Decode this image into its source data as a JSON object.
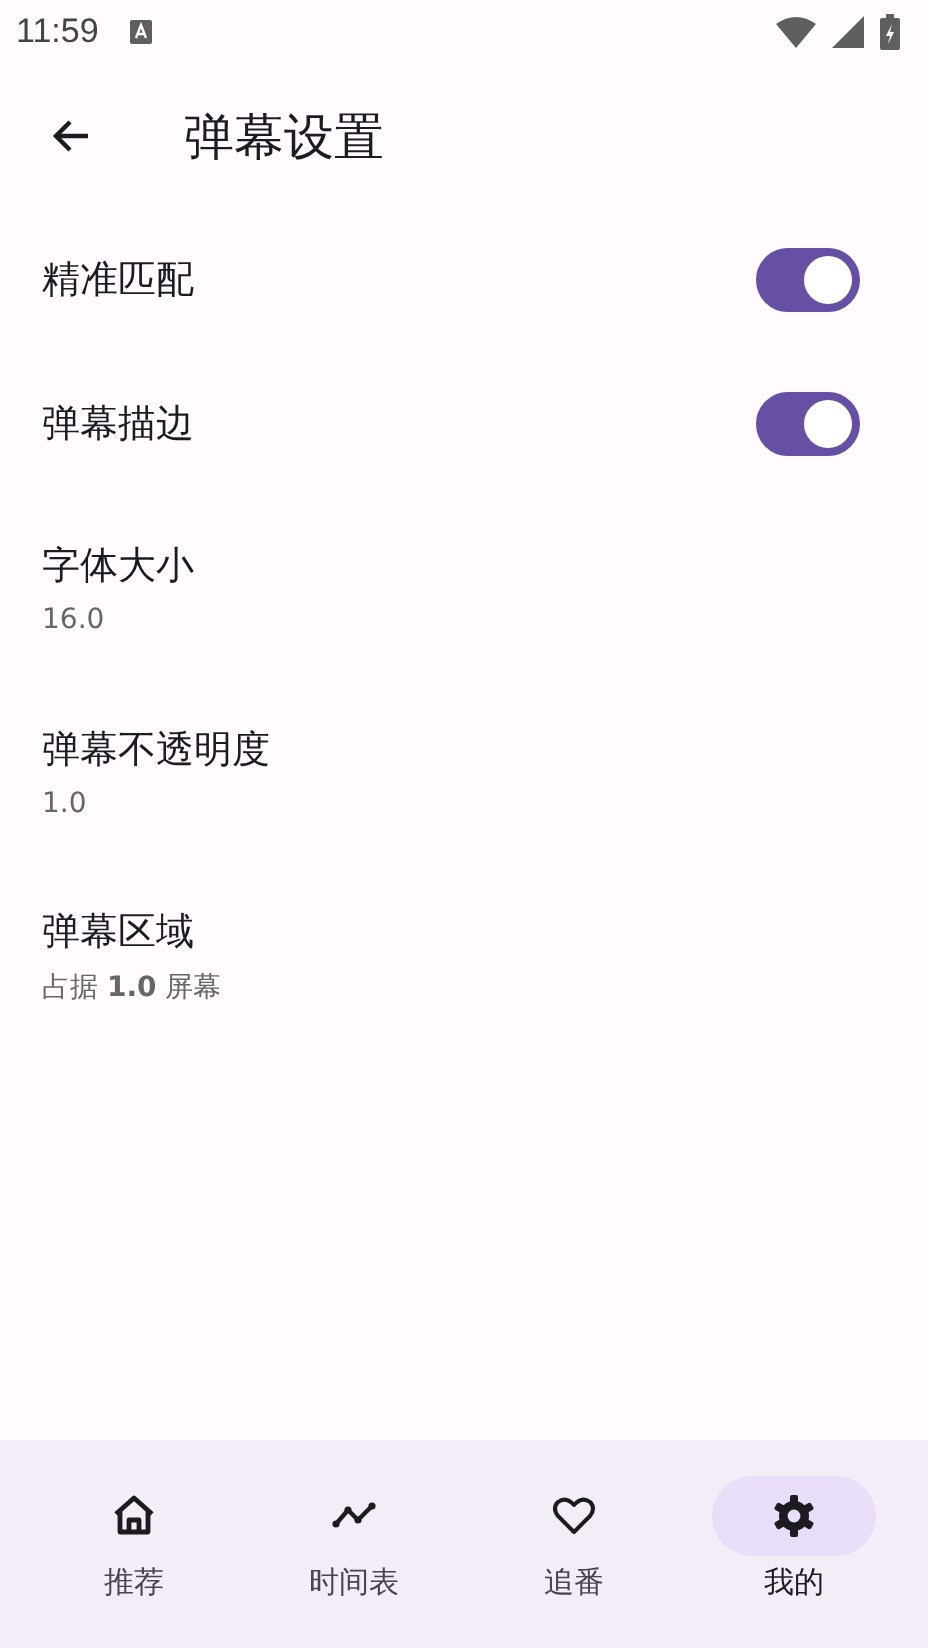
{
  "status_bar": {
    "time": "11:59"
  },
  "header": {
    "title": "弹幕设置"
  },
  "settings": [
    {
      "kind": "toggle",
      "label": "精准匹配",
      "on": true
    },
    {
      "kind": "toggle",
      "label": "弹幕描边",
      "on": true
    },
    {
      "kind": "value",
      "label": "字体大小",
      "value": "16.0"
    },
    {
      "kind": "value",
      "label": "弹幕不透明度",
      "value": "1.0"
    },
    {
      "kind": "value",
      "label": "弹幕区域",
      "value": "占据 **1.0** 屏幕"
    }
  ],
  "nav": [
    {
      "label": "推荐",
      "selected": false
    },
    {
      "label": "时间表",
      "selected": false
    },
    {
      "label": "追番",
      "selected": false
    },
    {
      "label": "我的",
      "selected": true
    }
  ]
}
